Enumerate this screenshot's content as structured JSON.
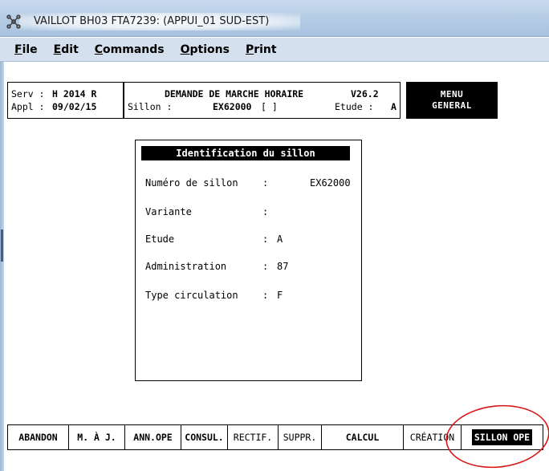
{
  "window": {
    "title": "VAILLOT BH03 FTA7239: (APPUI_01   SUD-EST)"
  },
  "menu": [
    {
      "key": "F",
      "rest": "ile"
    },
    {
      "key": "E",
      "rest": "dit"
    },
    {
      "key": "C",
      "rest": "ommands"
    },
    {
      "key": "O",
      "rest": "ptions"
    },
    {
      "key": "P",
      "rest": "rint"
    }
  ],
  "header": {
    "serv_label": "Serv :",
    "serv_value": "H 2014 R",
    "appl_label": "Appl :",
    "appl_value": "09/02/15",
    "title": "DEMANDE DE MARCHE HORAIRE",
    "version": "V26.2",
    "sillon_label": "Sillon :",
    "sillon_value": "EX62000",
    "sillon_bracket": "[ ]",
    "etude_label": "Etude :",
    "etude_value": "A",
    "menu_line1": "MENU",
    "menu_line2": "GENERAL"
  },
  "ident": {
    "title": "Identification du sillon",
    "rows": [
      {
        "label": "Numéro de sillon",
        "colon": ":",
        "value": "EX62000"
      },
      {
        "label": "Variante",
        "colon": ":",
        "value": ""
      },
      {
        "label": "Etude",
        "colon": ":",
        "value": "A"
      },
      {
        "label": "Administration",
        "colon": ":",
        "value": "87"
      },
      {
        "label": "Type circulation",
        "colon": ":",
        "value": "F"
      }
    ]
  },
  "fkeys": [
    "ABANDON",
    "M. À J.",
    "ANN.OPE",
    "CONSUL.",
    "RECTIF.",
    "SUPPR.",
    "CALCUL",
    "CRÉATION",
    "SILLON OPE"
  ],
  "colors": {
    "titlebar": "#b7cde6",
    "menubar": "#d4e0ee",
    "annotation": "#d81818",
    "inverse_bg": "#000000",
    "inverse_fg": "#ffffff"
  }
}
